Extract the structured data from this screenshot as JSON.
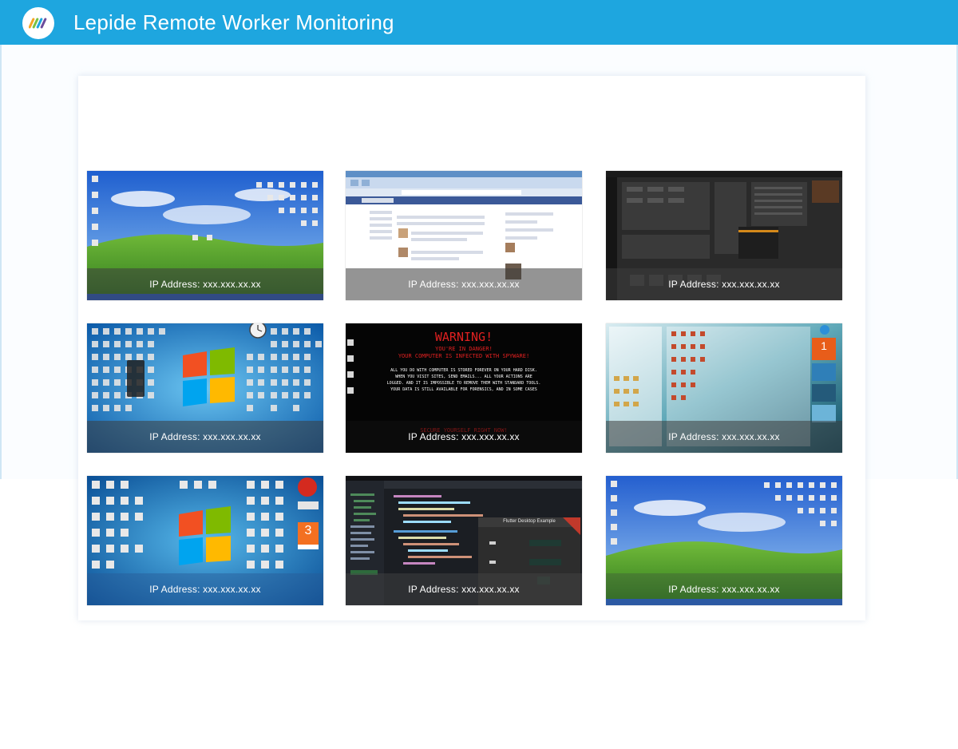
{
  "header": {
    "title": "Lepide Remote Worker Monitoring",
    "logo_icon": "lepide-logo-icon",
    "background": "#1ea6df"
  },
  "tiles": [
    {
      "ip": "IP Address: xxx.xxx.xx.xx",
      "desktop": "windows-xp-bliss"
    },
    {
      "ip": "IP Address: xxx.xxx.xx.xx",
      "desktop": "browser-social-feed"
    },
    {
      "ip": "IP Address: xxx.xxx.xx.xx",
      "desktop": "dark-audio-software"
    },
    {
      "ip": "IP Address: xxx.xxx.xx.xx",
      "desktop": "windows7-cluttered-icons"
    },
    {
      "ip": "IP Address: xxx.xxx.xx.xx",
      "desktop": "spyware-warning-screen"
    },
    {
      "ip": "IP Address: xxx.xxx.xx.xx",
      "desktop": "windows8-start-tiles"
    },
    {
      "ip": "IP Address: xxx.xxx.xx.xx",
      "desktop": "windows7-desktop"
    },
    {
      "ip": "IP Address: xxx.xxx.xx.xx",
      "desktop": "code-editor-dark"
    },
    {
      "ip": "IP Address: xxx.xxx.xx.xx",
      "desktop": "windows-xp-bliss"
    }
  ],
  "warning_screen": {
    "heading": "WARNING!",
    "line1": "YOU'RE IN DANGER!",
    "line2": "YOUR COMPUTER IS INFECTED WITH SPYWARE!",
    "body1": "ALL YOU DO WITH COMPUTER IS STORED FOREVER ON YOUR HARD DISK.",
    "body2": "WHEN YOU VISIT SITES, SEND EMAILS... ALL YOUR ACTIONS ARE",
    "body3": "LOGGED. AND IT IS IMPOSSIBLE TO REMOVE THEM WITH STANDARD TOOLS.",
    "body4": "YOUR DATA IS STILL AVAILABLE FOR FORENSICS, AND IN SOME CASES",
    "cta": "SECURE YOURSELF RIGHT NOW!"
  },
  "code_window": {
    "title": "Flutter Desktop Example"
  }
}
